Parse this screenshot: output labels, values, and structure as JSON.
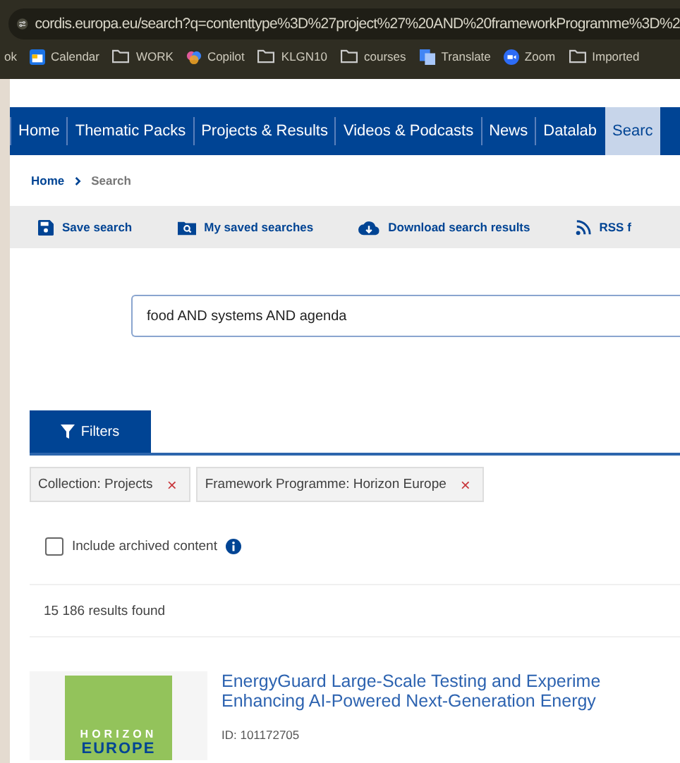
{
  "browser": {
    "url": "cordis.europa.eu/search?q=contenttype%3D%27project%27%20AND%20frameworkProgramme%3D%2",
    "bookmarks": [
      {
        "label": "ok",
        "kind": "cut"
      },
      {
        "label": "Calendar",
        "kind": "calendar"
      },
      {
        "label": "WORK",
        "kind": "folder"
      },
      {
        "label": "Copilot",
        "kind": "copilot"
      },
      {
        "label": "KLGN10",
        "kind": "folder"
      },
      {
        "label": "courses",
        "kind": "folder"
      },
      {
        "label": "Translate",
        "kind": "translate"
      },
      {
        "label": "Zoom",
        "kind": "zoom"
      },
      {
        "label": "Imported",
        "kind": "folder"
      }
    ]
  },
  "nav": [
    {
      "label": "Home",
      "selected": false
    },
    {
      "label": "Thematic Packs",
      "selected": false
    },
    {
      "label": "Projects & Results",
      "selected": false
    },
    {
      "label": "Videos & Podcasts",
      "selected": false
    },
    {
      "label": "News",
      "selected": false
    },
    {
      "label": "Datalab",
      "selected": false
    },
    {
      "label": "Searc",
      "selected": true
    }
  ],
  "breadcrumb": [
    "Home",
    "Search"
  ],
  "toolbar": [
    {
      "label": "Save search",
      "kind": "save"
    },
    {
      "label": "My saved searches",
      "kind": "saved"
    },
    {
      "label": "Download search results",
      "kind": "download"
    },
    {
      "label": "RSS f",
      "kind": "rss"
    }
  ],
  "search": {
    "value": "food AND systems AND agenda"
  },
  "filters_tab": {
    "label": "Filters"
  },
  "chips": [
    {
      "label": "Collection: Projects",
      "remove": "×"
    },
    {
      "label": "Framework Programme: Horizon Europe",
      "remove": "×"
    }
  ],
  "archived": {
    "label": "Include archived content",
    "checked": false
  },
  "results_count": "15 186 results found",
  "results": [
    {
      "logo": [
        "HORIZON",
        "EUROPE"
      ],
      "title": [
        "EnergyGuard Large-Scale Testing and Experime",
        "Enhancing AI-Powered Next-Generation Energy"
      ],
      "id": "ID: 101172705"
    }
  ]
}
